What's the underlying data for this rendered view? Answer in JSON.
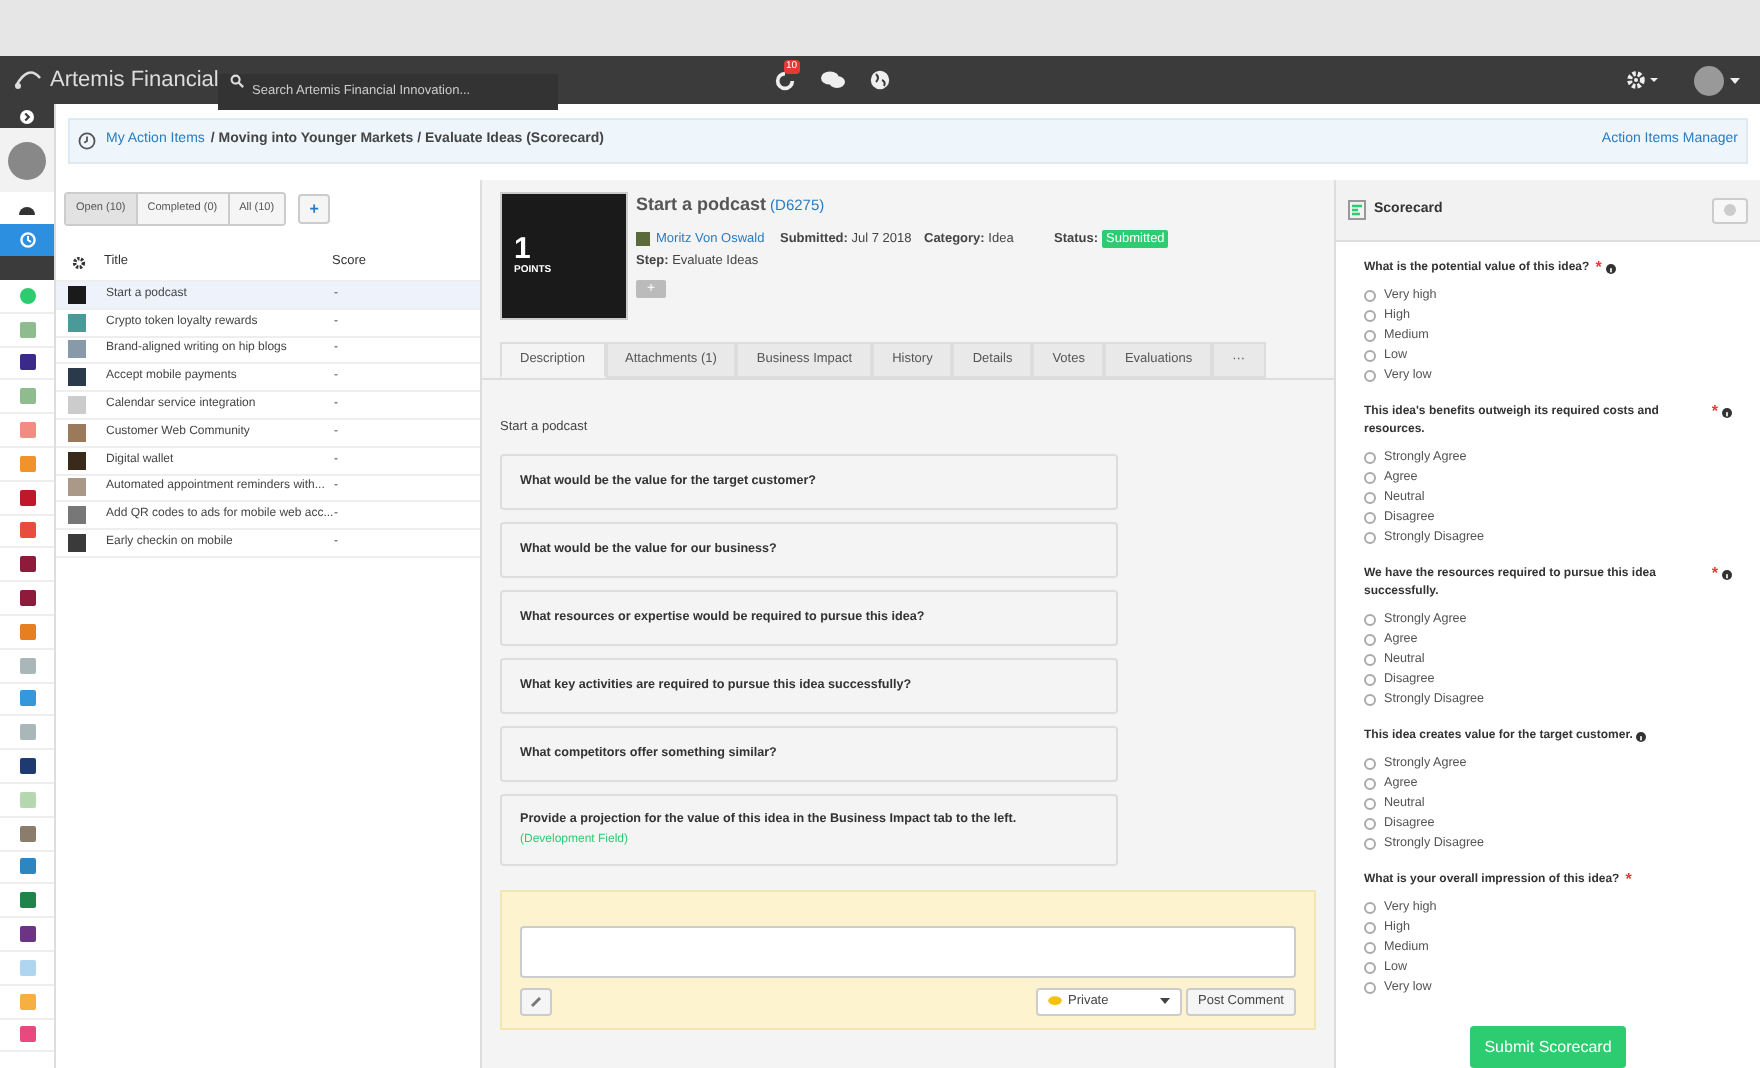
{
  "topbar": {
    "brand": "Artemis Financial",
    "search": {
      "placeholder": "Search Artemis Financial Innovation..."
    },
    "notification_count": "10"
  },
  "sidebar": {
    "nav": [
      {
        "kind": "dashboard",
        "selected": false
      },
      {
        "kind": "clock",
        "selected": true
      }
    ],
    "apps": [
      {
        "color": "#2ecc71"
      },
      {
        "color": "#8fbc8f"
      },
      {
        "color": "#3b2a8a"
      },
      {
        "color": "#8fbc8f"
      },
      {
        "color": "#f28b82"
      },
      {
        "color": "#f0932b"
      },
      {
        "color": "#c0172b"
      },
      {
        "color": "#e74c3c"
      },
      {
        "color": "#8e1b3c"
      },
      {
        "color": "#8e1b3c"
      },
      {
        "color": "#e67e22"
      },
      {
        "color": "#aab7b8"
      },
      {
        "color": "#3498db"
      },
      {
        "color": "#aab7b8"
      },
      {
        "color": "#1f3a6e"
      },
      {
        "color": "#b5d6b0"
      },
      {
        "color": "#8b7d6b"
      },
      {
        "color": "#2e86c1"
      },
      {
        "color": "#1e8449"
      },
      {
        "color": "#6c3483"
      },
      {
        "color": "#aed6f1"
      },
      {
        "color": "#f5b041"
      },
      {
        "color": "#e84a7f"
      }
    ]
  },
  "breadcrumb": {
    "link": "My Action Items",
    "rest": "/ Moving into Younger Markets / Evaluate Ideas (Scorecard)",
    "manager_link": "Action Items Manager"
  },
  "filters": [
    {
      "label": "Open (10)",
      "selected": true
    },
    {
      "label": "Completed (0)",
      "selected": false
    },
    {
      "label": "All (10)",
      "selected": false
    }
  ],
  "add_button": "+",
  "table": {
    "columns": [
      "Title",
      "Score"
    ],
    "rows": [
      {
        "title": "Start a podcast",
        "score": "-",
        "selected": true
      },
      {
        "title": "Crypto token loyalty rewards",
        "score": "-",
        "selected": false
      },
      {
        "title": "Brand-aligned writing on hip blogs",
        "score": "-",
        "selected": false
      },
      {
        "title": "Accept mobile payments",
        "score": "-",
        "selected": false
      },
      {
        "title": "Calendar service integration",
        "score": "-",
        "selected": false
      },
      {
        "title": "Customer Web Community",
        "score": "-",
        "selected": false
      },
      {
        "title": "Digital wallet",
        "score": "-",
        "selected": false
      },
      {
        "title": "Automated appointment reminders with...",
        "score": "-",
        "selected": false
      },
      {
        "title": "Add QR codes to ads for mobile web acc...",
        "score": "-",
        "selected": false
      },
      {
        "title": "Early checkin on mobile",
        "score": "-",
        "selected": false
      }
    ]
  },
  "idea": {
    "points": "1",
    "points_label": "POINTS",
    "title": "Start a podcast",
    "id": "(D6275)",
    "author": "Moritz Von Oswald",
    "submitted_label": "Submitted:",
    "submitted": "Jul 7 2018",
    "category_label": "Category:",
    "category": "Idea",
    "status_label": "Status:",
    "status": "Submitted",
    "step_label": "Step:",
    "step": "Evaluate Ideas",
    "plus": "+"
  },
  "tabs": [
    {
      "label": "Description",
      "selected": true
    },
    {
      "label": "Attachments (1)",
      "selected": false
    },
    {
      "label": "Business Impact",
      "selected": false
    },
    {
      "label": "History",
      "selected": false
    },
    {
      "label": "Details",
      "selected": false
    },
    {
      "label": "Votes",
      "selected": false
    },
    {
      "label": "Evaluations",
      "selected": false
    },
    {
      "label": "···",
      "selected": false
    }
  ],
  "description": "Start a podcast",
  "questions": [
    {
      "text": "What would be the value for the target customer?"
    },
    {
      "text": "What would be the value for our business?"
    },
    {
      "text": "What resources or expertise would be required to pursue this idea?"
    },
    {
      "text": "What key activities are required to pursue this idea successfully?"
    },
    {
      "text": "What competitors offer something similar?"
    },
    {
      "text": "Provide a projection for the value of this idea in the Business Impact tab to the left.",
      "note": "(Development Field)"
    }
  ],
  "comment": {
    "visibility": "Private",
    "post": "Post Comment"
  },
  "scorecard": {
    "title": "Scorecard",
    "submit": "Submit Scorecard",
    "questions": [
      {
        "text": "What is the potential value of this idea?",
        "required_mark": "*",
        "info": true,
        "options": [
          {
            "label": "Very high",
            "selected": false
          },
          {
            "label": "High",
            "selected": false
          },
          {
            "label": "Medium",
            "selected": false
          },
          {
            "label": "Low",
            "selected": false
          },
          {
            "label": "Very low",
            "selected": false
          }
        ]
      },
      {
        "text": "This idea's benefits outweigh its required costs and resources.",
        "required_mark": "*",
        "info": true,
        "options": [
          {
            "label": "Strongly Agree",
            "selected": false
          },
          {
            "label": "Agree",
            "selected": false
          },
          {
            "label": "Neutral",
            "selected": false
          },
          {
            "label": "Disagree",
            "selected": false
          },
          {
            "label": "Strongly Disagree",
            "selected": false
          }
        ]
      },
      {
        "text": "We have the resources required to pursue this idea successfully.",
        "required_mark": "*",
        "info": true,
        "options": [
          {
            "label": "Strongly Agree",
            "selected": false
          },
          {
            "label": "Agree",
            "selected": false
          },
          {
            "label": "Neutral",
            "selected": false
          },
          {
            "label": "Disagree",
            "selected": false
          },
          {
            "label": "Strongly Disagree",
            "selected": false
          }
        ]
      },
      {
        "text": "This idea creates value for the target customer.",
        "info": true,
        "options": [
          {
            "label": "Strongly Agree",
            "selected": false
          },
          {
            "label": "Agree",
            "selected": false
          },
          {
            "label": "Neutral",
            "selected": false
          },
          {
            "label": "Disagree",
            "selected": false
          },
          {
            "label": "Strongly Disagree",
            "selected": false
          }
        ]
      },
      {
        "text": "What is your overall impression of this idea?",
        "required_mark": "*",
        "options": [
          {
            "label": "Very high",
            "selected": false
          },
          {
            "label": "High",
            "selected": false
          },
          {
            "label": "Medium",
            "selected": false
          },
          {
            "label": "Low",
            "selected": false
          },
          {
            "label": "Very low",
            "selected": false
          }
        ]
      }
    ]
  }
}
